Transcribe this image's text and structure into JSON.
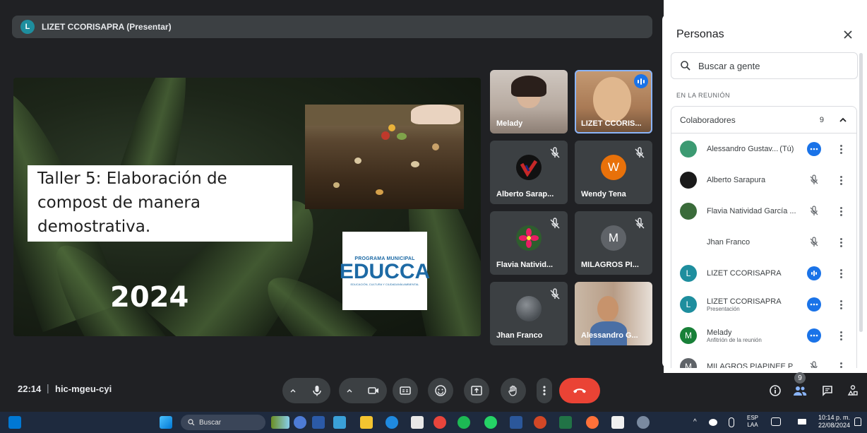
{
  "presenter": {
    "avatar_letter": "L",
    "label": "LIZET CCORISAPRA (Presentar)"
  },
  "slide": {
    "title": "Taller 5: Elaboración de compost de manera demostrativa.",
    "year": "2024",
    "logo_top": "PROGRAMA MUNICIPAL",
    "logo_main": "EDUCCA",
    "logo_sub": "EDUCACIÓN, CULTURA Y CIUDADANÍA AMBIENTAL"
  },
  "tiles": [
    {
      "name": "Melady",
      "type": "video"
    },
    {
      "name": "LIZET CCORIS...",
      "type": "video",
      "speaking": true
    },
    {
      "name": "Alberto Sarap...",
      "type": "avatar",
      "muted": true
    },
    {
      "name": "Wendy Tena",
      "type": "avatar",
      "letter": "W",
      "color": "#e8710a",
      "muted": true
    },
    {
      "name": "Flavia Nativid...",
      "type": "avatar",
      "muted": true
    },
    {
      "name": "MILAGROS PI...",
      "type": "avatar",
      "letter": "M",
      "color": "#5f6368",
      "muted": true
    },
    {
      "name": "Jhan Franco",
      "type": "avatar",
      "muted": true
    },
    {
      "name": "Alessandro G...",
      "type": "video"
    }
  ],
  "meeting": {
    "time": "22:14",
    "separator": "|",
    "code": "hic-mgeu-cyi",
    "people_count": "9"
  },
  "panel": {
    "title": "Personas",
    "search_placeholder": "Buscar a gente",
    "section_label": "EN LA REUNIÓN",
    "group_label": "Colaboradores",
    "group_count": "9",
    "people": [
      {
        "name": "Alessandro Gustav...",
        "you": "(Tú)",
        "sub": "",
        "avatar_color": "#3c9a72",
        "letter": "",
        "action": "more"
      },
      {
        "name": "Alberto Sarapura",
        "you": "",
        "sub": "",
        "avatar_color": "#1a1a1a",
        "letter": "",
        "action": "muted"
      },
      {
        "name": "Flavia Natividad García ...",
        "you": "",
        "sub": "",
        "avatar_color": "#3a6b3a",
        "letter": "",
        "action": "muted"
      },
      {
        "name": "Jhan Franco",
        "you": "",
        "sub": "",
        "avatar_color": "#ffffff",
        "letter": "",
        "action": "muted"
      },
      {
        "name": "LIZET CCORISAPRA",
        "you": "",
        "sub": "",
        "avatar_color": "#1e8e9e",
        "letter": "L",
        "action": "speaking"
      },
      {
        "name": "LIZET CCORISAPRA",
        "you": "",
        "sub": "Presentación",
        "avatar_color": "#1e8e9e",
        "letter": "L",
        "action": "more"
      },
      {
        "name": "Melady",
        "you": "",
        "sub": "Anfitrión de la reunión",
        "avatar_color": "#188038",
        "letter": "M",
        "action": "more"
      },
      {
        "name": "MILAGROS PIAPINEE P",
        "you": "",
        "sub": "",
        "avatar_color": "#5f6368",
        "letter": "M",
        "action": "muted"
      }
    ]
  },
  "taskbar": {
    "search_label": "Buscar",
    "lang_top": "ESP",
    "lang_bottom": "LAA",
    "clock_time": "10:14 p. m.",
    "clock_date": "22/08/2024"
  },
  "colors": {
    "meet_bg": "#202124",
    "leave_red": "#ea4335",
    "accent_blue": "#1a73e8"
  }
}
